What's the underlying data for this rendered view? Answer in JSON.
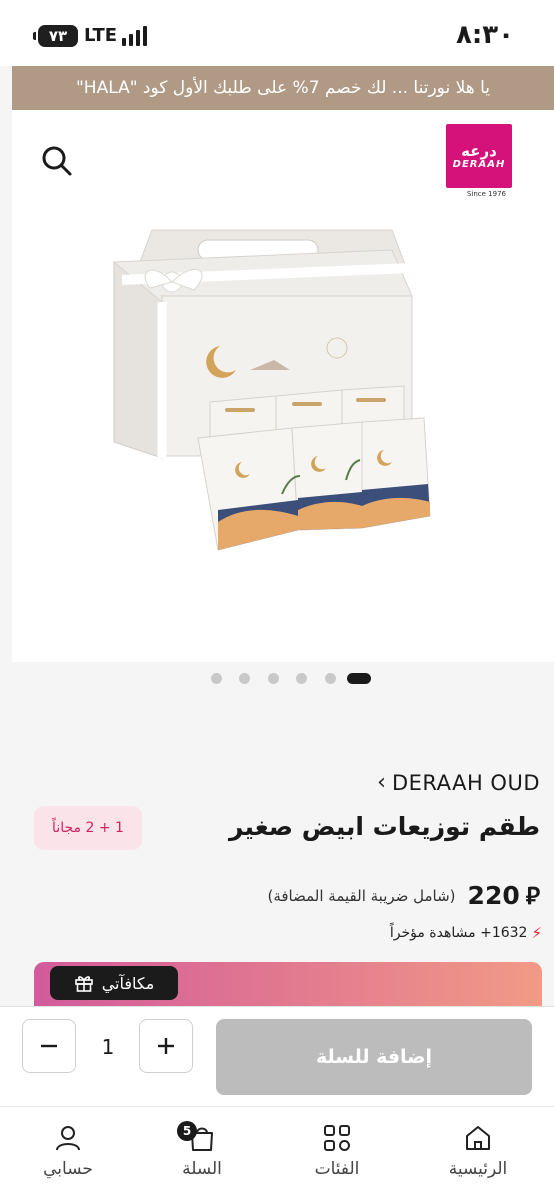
{
  "status_bar": {
    "time": "٨:٣٠",
    "battery": "٧٣",
    "network": "LTE"
  },
  "promo_banner": {
    "text": "يا هلا نورتنا ... لك خصم 7% على طلبك الأول كود \"HALA\""
  },
  "header": {
    "logo_ar": "درعه",
    "logo_en": "DERAAH",
    "logo_since": "Since 1976",
    "brand_color": "#d5117a"
  },
  "gallery": {
    "dot_count": 6,
    "active_dot": 6
  },
  "product": {
    "brand": "DERAAH OUD",
    "title": "طقم توزيعات ابيض صغير",
    "offer_badge": "1 + 2 مجاناً",
    "price": "220",
    "currency_icon": "saudi-riyal-icon",
    "vat_note": "(شامل ضريبة القيمة المضافة)",
    "recent_views": "1632+ مشاهدة مؤخراً"
  },
  "rewards": {
    "label": "مكافآتي"
  },
  "cart_bar": {
    "quantity": "1",
    "add_to_cart_label": "إضافة للسلة"
  },
  "bottom_nav": {
    "home_label": "الرئيسية",
    "categories_label": "الفئات",
    "cart_label": "السلة",
    "cart_count": "5",
    "account_label": "حسابي"
  }
}
